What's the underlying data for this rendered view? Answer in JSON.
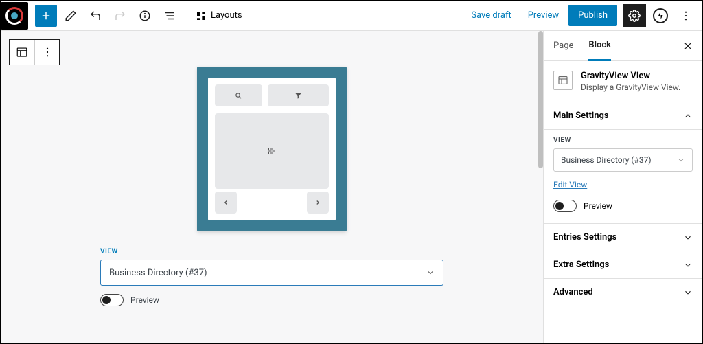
{
  "toolbar": {
    "layouts_label": "Layouts",
    "save_draft": "Save draft",
    "preview": "Preview",
    "publish": "Publish"
  },
  "canvas": {
    "view_label": "VIEW",
    "view_value": "Business Directory (#37)",
    "preview_toggle_label": "Preview"
  },
  "sidebar": {
    "tabs": {
      "page": "Page",
      "block": "Block"
    },
    "block": {
      "title": "GravityView View",
      "description": "Display a GravityView View."
    },
    "panels": {
      "main_settings": {
        "title": "Main Settings",
        "view_label": "VIEW",
        "view_value": "Business Directory (#37)",
        "edit_link": "Edit View",
        "preview_label": "Preview"
      },
      "entries": "Entries Settings",
      "extra": "Extra Settings",
      "advanced": "Advanced"
    }
  }
}
